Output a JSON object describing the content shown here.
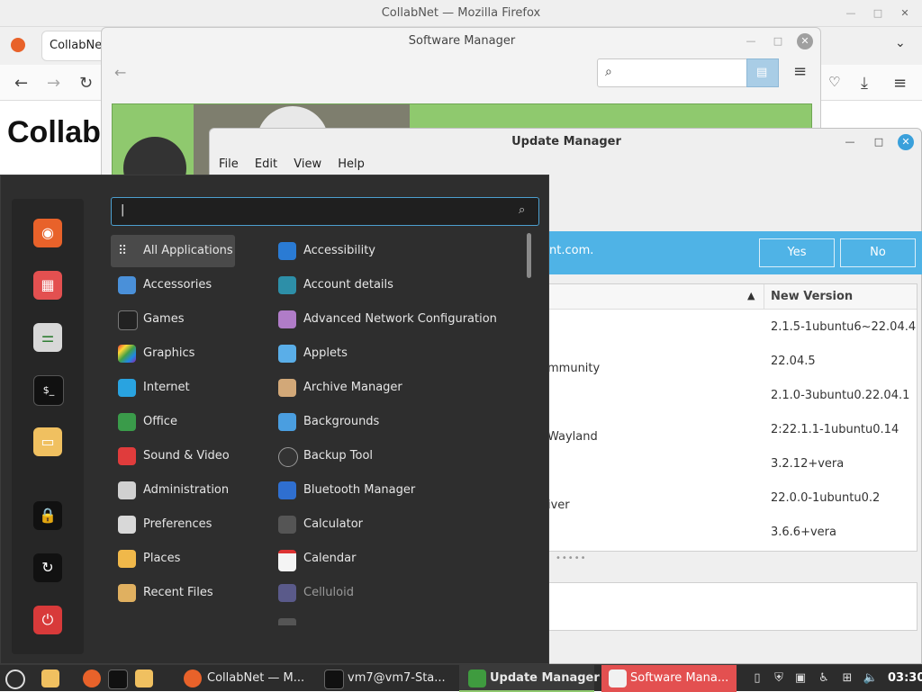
{
  "firefox": {
    "window_title": "CollabNet — Mozilla Firefox",
    "tab_label": "CollabNe",
    "page_heading": "Collab"
  },
  "software_manager": {
    "title": "Software Manager"
  },
  "update_manager": {
    "title": "Update Manager",
    "menu": [
      "File",
      "Edit",
      "View",
      "Help"
    ],
    "info_text": "nt.com.",
    "yes_label": "Yes",
    "no_label": "No",
    "column_new_version": "New Version",
    "sort_indicator": "▲",
    "rows": [
      {
        "name": "",
        "version": "2.1.5-1ubuntu6~22.04.4"
      },
      {
        "name": "mmunity",
        "version": "22.04.5"
      },
      {
        "name": "",
        "version": "2.1.0-3ubuntu0.22.04.1"
      },
      {
        "name": "Wayland",
        "version": "2:22.1.1-1ubuntu0.14"
      },
      {
        "name": "",
        "version": "3.2.12+vera"
      },
      {
        "name": "iver",
        "version": "22.0.0-1ubuntu0.2"
      },
      {
        "name": "",
        "version": "3.6.6+vera"
      }
    ]
  },
  "menu": {
    "search_value": "|",
    "categories": [
      "All Applications",
      "Accessories",
      "Games",
      "Graphics",
      "Internet",
      "Office",
      "Sound & Video",
      "Administration",
      "Preferences",
      "Places",
      "Recent Files"
    ],
    "apps": [
      "Accessibility",
      "Account details",
      "Advanced Network Configuration",
      "Applets",
      "Archive Manager",
      "Backgrounds",
      "Backup Tool",
      "Bluetooth Manager",
      "Calculator",
      "Calendar",
      "Celluloid"
    ],
    "favorites": [
      "firefox-icon",
      "software-manager-icon",
      "settings-icon",
      "terminal-icon",
      "files-icon",
      "lock-icon",
      "logout-icon",
      "power-icon"
    ]
  },
  "taskbar": {
    "windows": [
      {
        "label": "CollabNet — M..."
      },
      {
        "label": "vm7@vm7-Sta..."
      },
      {
        "label": "Update Manager"
      },
      {
        "label": "Software Mana..."
      }
    ],
    "clock": "03:30"
  },
  "colors": {
    "accent_blue": "#4fb3e6",
    "menu_bg": "#2e2e2e",
    "taskbar_bg": "#2c2c2c",
    "software_red": "#e35050",
    "mint_green": "#8fc96e"
  }
}
